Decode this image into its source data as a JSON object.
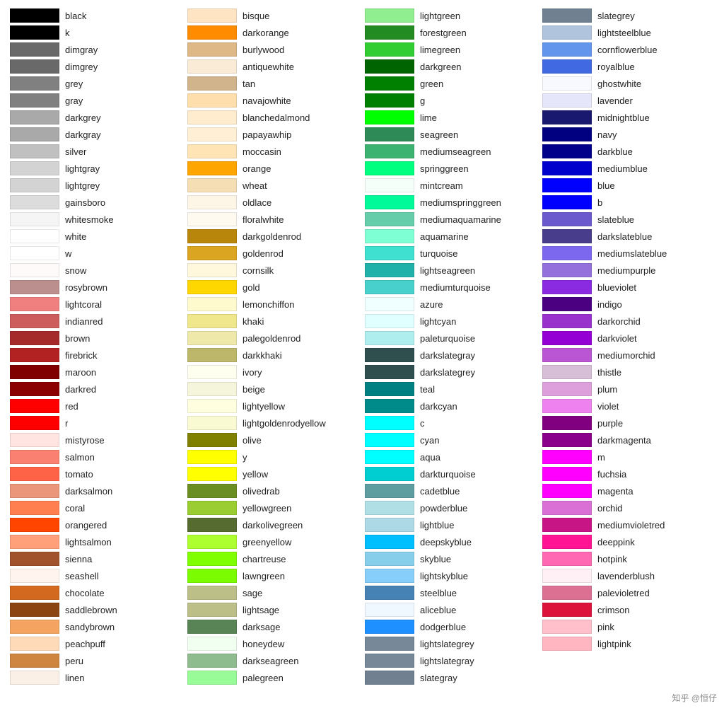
{
  "columns": [
    [
      {
        "name": "black",
        "color": "#000000"
      },
      {
        "name": "k",
        "color": "#000000"
      },
      {
        "name": "dimgray",
        "color": "#696969"
      },
      {
        "name": "dimgrey",
        "color": "#696969"
      },
      {
        "name": "grey",
        "color": "#808080"
      },
      {
        "name": "gray",
        "color": "#808080"
      },
      {
        "name": "darkgrey",
        "color": "#a9a9a9"
      },
      {
        "name": "darkgray",
        "color": "#a9a9a9"
      },
      {
        "name": "silver",
        "color": "#c0c0c0"
      },
      {
        "name": "lightgray",
        "color": "#d3d3d3"
      },
      {
        "name": "lightgrey",
        "color": "#d3d3d3"
      },
      {
        "name": "gainsboro",
        "color": "#dcdcdc"
      },
      {
        "name": "whitesmoke",
        "color": "#f5f5f5"
      },
      {
        "name": "white",
        "color": "#ffffff"
      },
      {
        "name": "w",
        "color": "#ffffff"
      },
      {
        "name": "snow",
        "color": "#fffafa"
      },
      {
        "name": "rosybrown",
        "color": "#bc8f8f"
      },
      {
        "name": "lightcoral",
        "color": "#f08080"
      },
      {
        "name": "indianred",
        "color": "#cd5c5c"
      },
      {
        "name": "brown",
        "color": "#a52a2a"
      },
      {
        "name": "firebrick",
        "color": "#b22222"
      },
      {
        "name": "maroon",
        "color": "#800000"
      },
      {
        "name": "darkred",
        "color": "#8b0000"
      },
      {
        "name": "red",
        "color": "#ff0000"
      },
      {
        "name": "r",
        "color": "#ff0000"
      },
      {
        "name": "mistyrose",
        "color": "#ffe4e1"
      },
      {
        "name": "salmon",
        "color": "#fa8072"
      },
      {
        "name": "tomato",
        "color": "#ff6347"
      },
      {
        "name": "darksalmon",
        "color": "#e9967a"
      },
      {
        "name": "coral",
        "color": "#ff7f50"
      },
      {
        "name": "orangered",
        "color": "#ff4500"
      },
      {
        "name": "lightsalmon",
        "color": "#ffa07a"
      },
      {
        "name": "sienna",
        "color": "#a0522d"
      },
      {
        "name": "seashell",
        "color": "#fff5ee"
      },
      {
        "name": "chocolate",
        "color": "#d2691e"
      },
      {
        "name": "saddlebrown",
        "color": "#8b4513"
      },
      {
        "name": "sandybrown",
        "color": "#f4a460"
      },
      {
        "name": "peachpuff",
        "color": "#ffdab9"
      },
      {
        "name": "peru",
        "color": "#cd853f"
      },
      {
        "name": "linen",
        "color": "#faf0e6"
      }
    ],
    [
      {
        "name": "bisque",
        "color": "#ffe4c4"
      },
      {
        "name": "darkorange",
        "color": "#ff8c00"
      },
      {
        "name": "burlywood",
        "color": "#deb887"
      },
      {
        "name": "antiquewhite",
        "color": "#faebd7"
      },
      {
        "name": "tan",
        "color": "#d2b48c"
      },
      {
        "name": "navajowhite",
        "color": "#ffdead"
      },
      {
        "name": "blanchedalmond",
        "color": "#ffebcd"
      },
      {
        "name": "papayawhip",
        "color": "#ffefd5"
      },
      {
        "name": "moccasin",
        "color": "#ffe4b5"
      },
      {
        "name": "orange",
        "color": "#ffa500"
      },
      {
        "name": "wheat",
        "color": "#f5deb3"
      },
      {
        "name": "oldlace",
        "color": "#fdf5e6"
      },
      {
        "name": "floralwhite",
        "color": "#fffaf0"
      },
      {
        "name": "darkgoldenrod",
        "color": "#b8860b"
      },
      {
        "name": "goldenrod",
        "color": "#daa520"
      },
      {
        "name": "cornsilk",
        "color": "#fff8dc"
      },
      {
        "name": "gold",
        "color": "#ffd700"
      },
      {
        "name": "lemonchiffon",
        "color": "#fffacd"
      },
      {
        "name": "khaki",
        "color": "#f0e68c"
      },
      {
        "name": "palegoldenrod",
        "color": "#eee8aa"
      },
      {
        "name": "darkkhaki",
        "color": "#bdb76b"
      },
      {
        "name": "ivory",
        "color": "#fffff0"
      },
      {
        "name": "beige",
        "color": "#f5f5dc"
      },
      {
        "name": "lightyellow",
        "color": "#ffffe0"
      },
      {
        "name": "lightgoldenrodyellow",
        "color": "#fafad2"
      },
      {
        "name": "olive",
        "color": "#808000"
      },
      {
        "name": "y",
        "color": "#ffff00"
      },
      {
        "name": "yellow",
        "color": "#ffff00"
      },
      {
        "name": "olivedrab",
        "color": "#6b8e23"
      },
      {
        "name": "yellowgreen",
        "color": "#9acd32"
      },
      {
        "name": "darkolivegreen",
        "color": "#556b2f"
      },
      {
        "name": "greenyellow",
        "color": "#adff2f"
      },
      {
        "name": "chartreuse",
        "color": "#7fff00"
      },
      {
        "name": "lawngreen",
        "color": "#7cfc00"
      },
      {
        "name": "sage",
        "color": "#bcbf87"
      },
      {
        "name": "lightsage",
        "color": "#bcbf87"
      },
      {
        "name": "darksage",
        "color": "#598556"
      },
      {
        "name": "honeydew",
        "color": "#f0fff0"
      },
      {
        "name": "darkseagreen",
        "color": "#8fbc8f"
      },
      {
        "name": "palegreen",
        "color": "#98fb98"
      }
    ],
    [
      {
        "name": "lightgreen",
        "color": "#90ee90"
      },
      {
        "name": "forestgreen",
        "color": "#228b22"
      },
      {
        "name": "limegreen",
        "color": "#32cd32"
      },
      {
        "name": "darkgreen",
        "color": "#006400"
      },
      {
        "name": "green",
        "color": "#008000"
      },
      {
        "name": "g",
        "color": "#008000"
      },
      {
        "name": "lime",
        "color": "#00ff00"
      },
      {
        "name": "seagreen",
        "color": "#2e8b57"
      },
      {
        "name": "mediumseagreen",
        "color": "#3cb371"
      },
      {
        "name": "springgreen",
        "color": "#00ff7f"
      },
      {
        "name": "mintcream",
        "color": "#f5fffa"
      },
      {
        "name": "mediumspringgreen",
        "color": "#00fa9a"
      },
      {
        "name": "mediumaquamarine",
        "color": "#66cdaa"
      },
      {
        "name": "aquamarine",
        "color": "#7fffd4"
      },
      {
        "name": "turquoise",
        "color": "#40e0d0"
      },
      {
        "name": "lightseagreen",
        "color": "#20b2aa"
      },
      {
        "name": "mediumturquoise",
        "color": "#48d1cc"
      },
      {
        "name": "azure",
        "color": "#f0ffff"
      },
      {
        "name": "lightcyan",
        "color": "#e0ffff"
      },
      {
        "name": "paleturquoise",
        "color": "#afeeee"
      },
      {
        "name": "darkslategray",
        "color": "#2f4f4f"
      },
      {
        "name": "darkslategrey",
        "color": "#2f4f4f"
      },
      {
        "name": "teal",
        "color": "#008080"
      },
      {
        "name": "darkcyan",
        "color": "#008b8b"
      },
      {
        "name": "c",
        "color": "#00ffff"
      },
      {
        "name": "cyan",
        "color": "#00ffff"
      },
      {
        "name": "aqua",
        "color": "#00ffff"
      },
      {
        "name": "darkturquoise",
        "color": "#00ced1"
      },
      {
        "name": "cadetblue",
        "color": "#5f9ea0"
      },
      {
        "name": "powderblue",
        "color": "#b0e0e6"
      },
      {
        "name": "lightblue",
        "color": "#add8e6"
      },
      {
        "name": "deepskyblue",
        "color": "#00bfff"
      },
      {
        "name": "skyblue",
        "color": "#87ceeb"
      },
      {
        "name": "lightskyblue",
        "color": "#87cefa"
      },
      {
        "name": "steelblue",
        "color": "#4682b4"
      },
      {
        "name": "aliceblue",
        "color": "#f0f8ff"
      },
      {
        "name": "dodgerblue",
        "color": "#1e90ff"
      },
      {
        "name": "lightslategrey",
        "color": "#778899"
      },
      {
        "name": "lightslategray",
        "color": "#778899"
      },
      {
        "name": "slategray",
        "color": "#708090"
      }
    ],
    [
      {
        "name": "slategrey",
        "color": "#708090"
      },
      {
        "name": "lightsteelblue",
        "color": "#b0c4de"
      },
      {
        "name": "cornflowerblue",
        "color": "#6495ed"
      },
      {
        "name": "royalblue",
        "color": "#4169e1"
      },
      {
        "name": "ghostwhite",
        "color": "#f8f8ff"
      },
      {
        "name": "lavender",
        "color": "#e6e6fa"
      },
      {
        "name": "midnightblue",
        "color": "#191970"
      },
      {
        "name": "navy",
        "color": "#000080"
      },
      {
        "name": "darkblue",
        "color": "#00008b"
      },
      {
        "name": "mediumblue",
        "color": "#0000cd"
      },
      {
        "name": "blue",
        "color": "#0000ff"
      },
      {
        "name": "b",
        "color": "#0000ff"
      },
      {
        "name": "slateblue",
        "color": "#6a5acd"
      },
      {
        "name": "darkslateblue",
        "color": "#483d8b"
      },
      {
        "name": "mediumslateblue",
        "color": "#7b68ee"
      },
      {
        "name": "mediumpurple",
        "color": "#9370db"
      },
      {
        "name": "blueviolet",
        "color": "#8a2be2"
      },
      {
        "name": "indigo",
        "color": "#4b0082"
      },
      {
        "name": "darkorchid",
        "color": "#9932cc"
      },
      {
        "name": "darkviolet",
        "color": "#9400d3"
      },
      {
        "name": "mediumorchid",
        "color": "#ba55d3"
      },
      {
        "name": "thistle",
        "color": "#d8bfd8"
      },
      {
        "name": "plum",
        "color": "#dda0dd"
      },
      {
        "name": "violet",
        "color": "#ee82ee"
      },
      {
        "name": "purple",
        "color": "#800080"
      },
      {
        "name": "darkmagenta",
        "color": "#8b008b"
      },
      {
        "name": "m",
        "color": "#ff00ff"
      },
      {
        "name": "fuchsia",
        "color": "#ff00ff"
      },
      {
        "name": "magenta",
        "color": "#ff00ff"
      },
      {
        "name": "orchid",
        "color": "#da70d6"
      },
      {
        "name": "mediumvioletred",
        "color": "#c71585"
      },
      {
        "name": "deeppink",
        "color": "#ff1493"
      },
      {
        "name": "hotpink",
        "color": "#ff69b4"
      },
      {
        "name": "lavenderblush",
        "color": "#fff0f5"
      },
      {
        "name": "palevioletred",
        "color": "#db7093"
      },
      {
        "name": "crimson",
        "color": "#dc143c"
      },
      {
        "name": "pink",
        "color": "#ffc0cb"
      },
      {
        "name": "lightpink",
        "color": "#ffb6c1"
      },
      {
        "name": "",
        "color": "transparent"
      },
      {
        "name": "",
        "color": "transparent"
      }
    ]
  ],
  "watermark": "知乎 @恒仔"
}
